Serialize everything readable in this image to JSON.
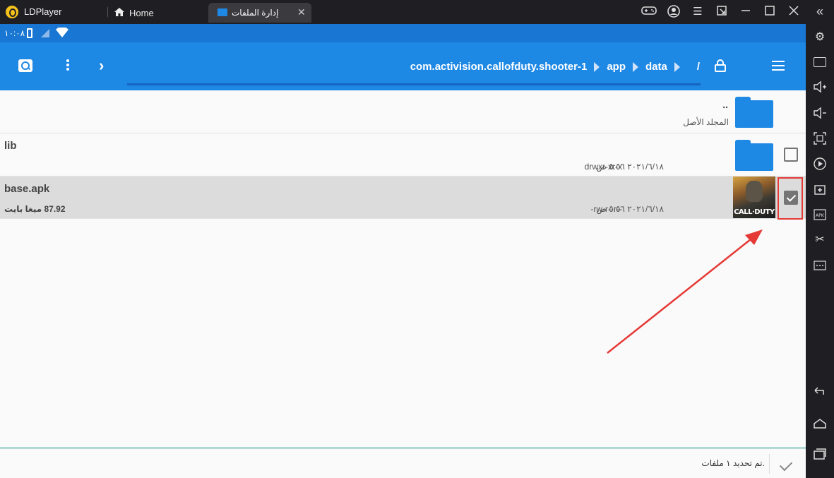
{
  "titlebar": {
    "app_name": "LDPlayer",
    "tabs": [
      {
        "label": "Home"
      },
      {
        "label": "إدارة الملفات"
      }
    ],
    "icons": [
      "gamepad-icon",
      "account-icon",
      "menu-icon",
      "restore-icon",
      "minimize-icon",
      "maximize-icon",
      "close-icon",
      "collapse-icon"
    ]
  },
  "statusbar": {
    "time": "١٠:٠٨"
  },
  "toolbar": {
    "breadcrumbs": [
      "com.activision.callofduty.shooter-1",
      "app",
      "data",
      "/"
    ]
  },
  "files": [
    {
      "name": "..",
      "subtitle": "المجلد الأصل",
      "type": "parent-folder"
    },
    {
      "name": "lib",
      "date": "٢٠٢١/٦/١٨ ٥:٥٦ ص",
      "perms": "drwxr-xr-x",
      "type": "folder",
      "checked": false
    },
    {
      "name": "base.apk",
      "date": "٢٠٢١/٦/١٨ ٥:٥٦ ص",
      "perms": "-rw-r--r--",
      "size": "87.92 ميغا بايت",
      "type": "apk",
      "checked": true,
      "thumb_text": "CALL·DUTY"
    }
  ],
  "bottom": {
    "status": "تم تحديد ١ ملفات."
  },
  "colors": {
    "primary": "#1e88e5",
    "status_bar": "#1976d2",
    "highlight": "#e53935"
  }
}
